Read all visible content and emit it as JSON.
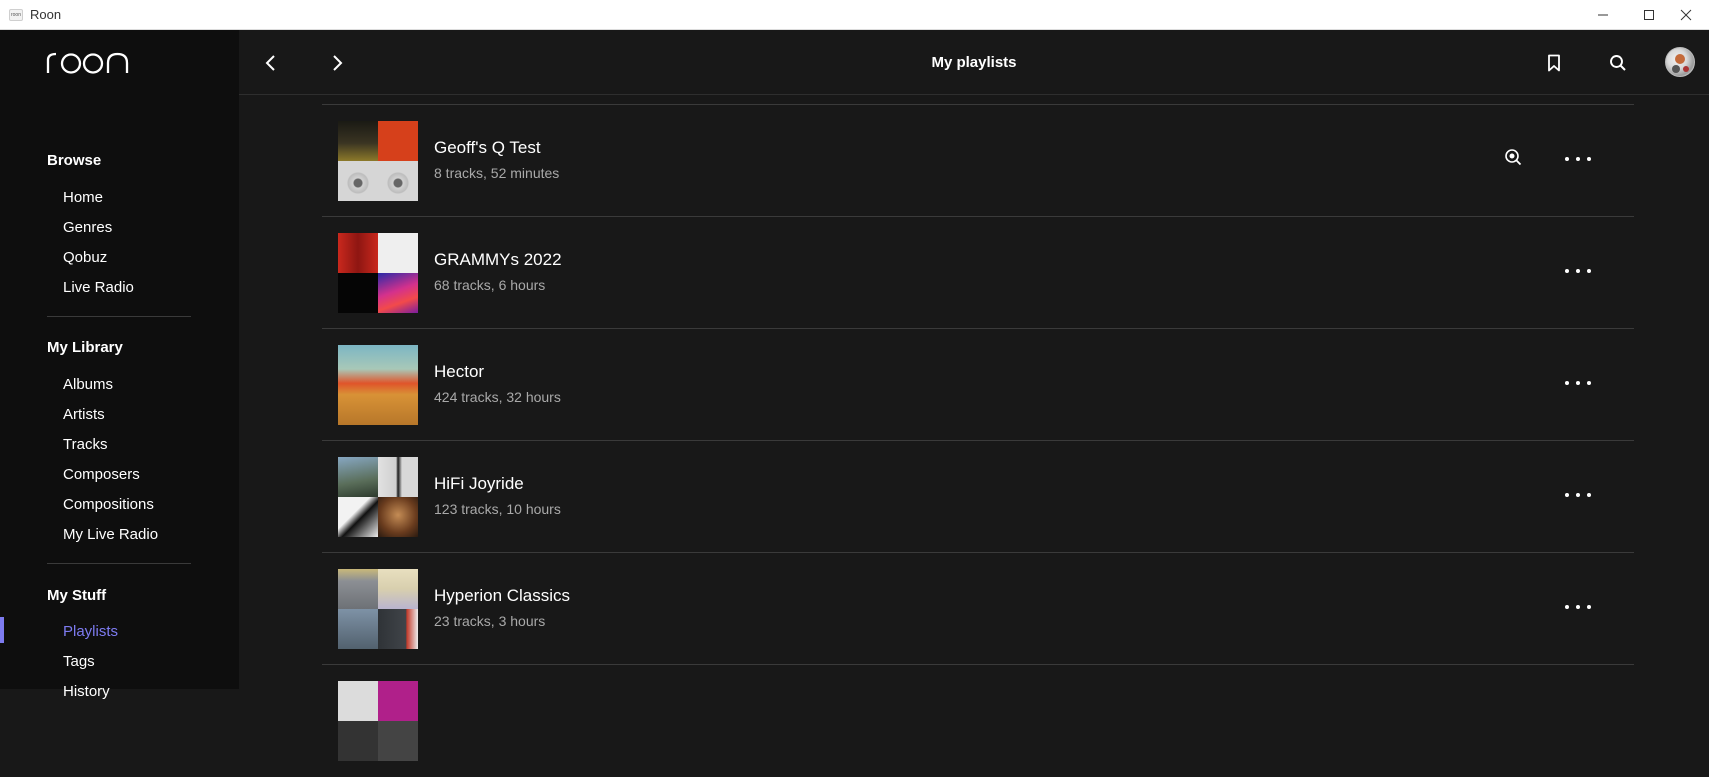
{
  "window": {
    "title": "Roon",
    "icon_text": "roon"
  },
  "header": {
    "title": "My playlists"
  },
  "sidebar": {
    "browse": {
      "heading": "Browse",
      "items": [
        "Home",
        "Genres",
        "Qobuz",
        "Live Radio"
      ]
    },
    "library": {
      "heading": "My Library",
      "items": [
        "Albums",
        "Artists",
        "Tracks",
        "Composers",
        "Compositions",
        "My Live Radio"
      ]
    },
    "stuff": {
      "heading": "My Stuff",
      "items": [
        "Playlists",
        "Tags",
        "History"
      ],
      "active": "Playlists"
    }
  },
  "playlists": [
    {
      "name": "Geoff's Q Test",
      "meta": "8 tracks, 52 minutes",
      "cover": [
        "#2d2a1c",
        "#d6401b",
        "#d2d2d2",
        "#cfcfcf"
      ]
    },
    {
      "name": "GRAMMYs 2022",
      "meta": "68 tracks, 6 hours",
      "cover": [
        "#b8231c",
        "#eeeeee",
        "#050505",
        "#c42a8c"
      ]
    },
    {
      "name": "Hector",
      "meta": "424 tracks, 32 hours",
      "cover": [
        "#6aa7b5",
        "#8fb9b0",
        "#d98a2c",
        "#c56a1f"
      ]
    },
    {
      "name": "HiFi Joyride",
      "meta": "123 tracks, 10 hours",
      "cover": [
        "#6e8aa0",
        "#c8c8c8",
        "#1e1e1e",
        "#7a4a2a"
      ]
    },
    {
      "name": "Hyperion Classics",
      "meta": "23 tracks, 3 hours",
      "cover": [
        "#8c8f94",
        "#c8b98a",
        "#52616e",
        "#35393d"
      ]
    }
  ],
  "colors": {
    "accent": "#7d7bf0",
    "background": "#181818",
    "sidebar": "#0e0e0e"
  }
}
